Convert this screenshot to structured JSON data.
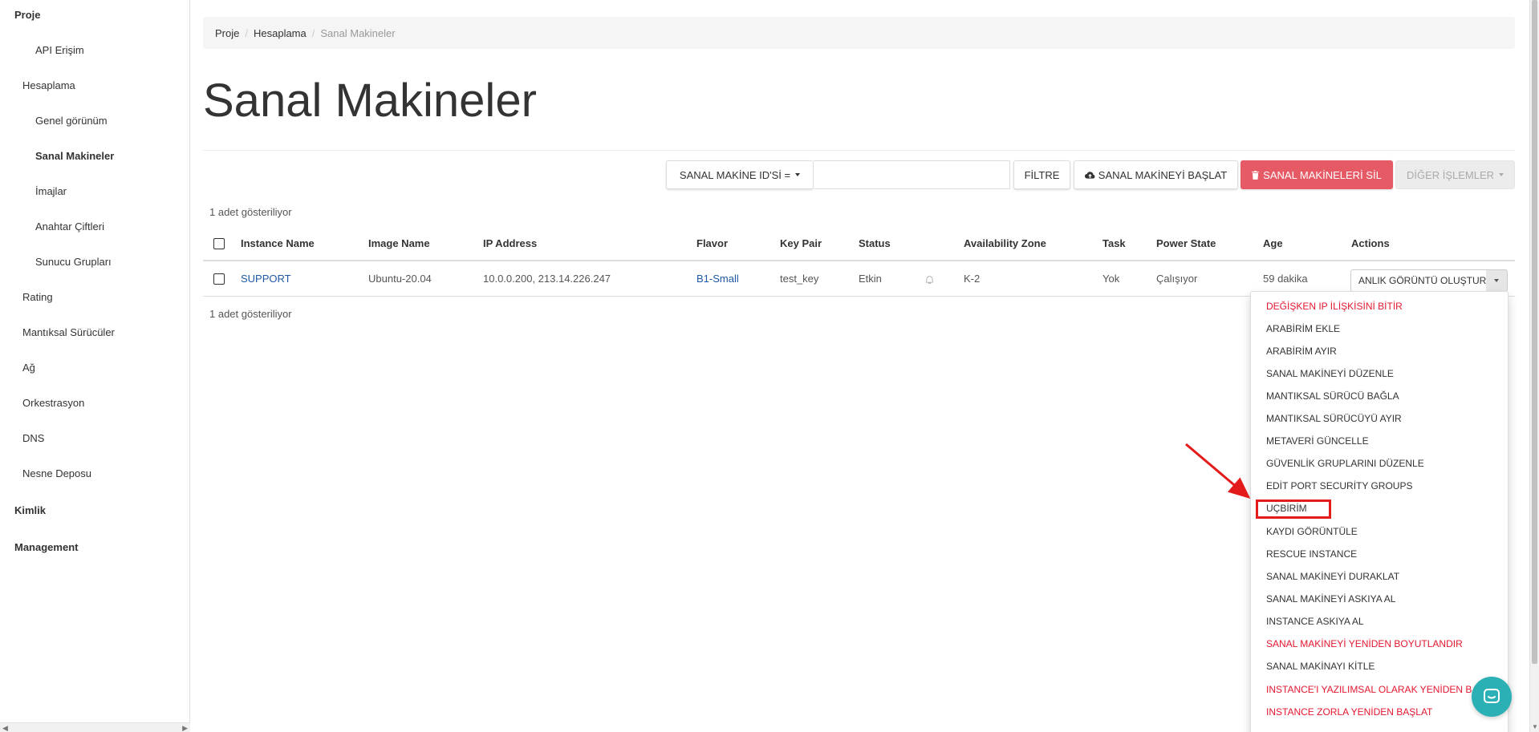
{
  "sidebar": {
    "groups": [
      {
        "label": "Proje"
      },
      {
        "label": "Kimlik"
      },
      {
        "label": "Management"
      }
    ],
    "items": [
      {
        "label": "API Erişim"
      },
      {
        "label": "Hesaplama"
      },
      {
        "label": "Genel görünüm"
      },
      {
        "label": "Sanal Makineler"
      },
      {
        "label": "İmajlar"
      },
      {
        "label": "Anahtar Çiftleri"
      },
      {
        "label": "Sunucu Grupları"
      },
      {
        "label": "Rating"
      },
      {
        "label": "Mantıksal Sürücüler"
      },
      {
        "label": "Ağ"
      },
      {
        "label": "Orkestrasyon"
      },
      {
        "label": "DNS"
      },
      {
        "label": "Nesne Deposu"
      }
    ]
  },
  "breadcrumb": [
    "Proje",
    "Hesaplama",
    "Sanal Makineler"
  ],
  "page_title": "Sanal Makineler",
  "toolbar": {
    "filter_select": "SANAL MAKİNE ID'Sİ =",
    "filter_value": "",
    "filter_button": "FİLTRE",
    "launch_button": "SANAL MAKİNEYİ BAŞLAT",
    "delete_button": "SANAL MAKİNELERİ SİL",
    "more_button": "DİĞER İŞLEMLER"
  },
  "count_text": "1 adet gösteriliyor",
  "table": {
    "columns": [
      "Instance Name",
      "Image Name",
      "IP Address",
      "Flavor",
      "Key Pair",
      "Status",
      "Availability Zone",
      "Task",
      "Power State",
      "Age",
      "Actions"
    ],
    "rows": [
      {
        "instance_name": "SUPPORT",
        "image_name": "Ubuntu-20.04",
        "ip_address": "10.0.0.200, 213.14.226.247",
        "flavor": "B1-Small",
        "key_pair": "test_key",
        "status": "Etkin",
        "availability_zone": "K-2",
        "task": "Yok",
        "power_state": "Çalışıyor",
        "age": "59 dakika",
        "action": "ANLIK GÖRÜNTÜ OLUŞTUR"
      }
    ]
  },
  "actions_menu": [
    {
      "label": "DEĞİŞKEN IP İLİŞKİSİNİ BİTİR",
      "danger": true
    },
    {
      "label": "ARABİRİM EKLE",
      "danger": false
    },
    {
      "label": "ARABİRİM AYIR",
      "danger": false
    },
    {
      "label": "SANAL MAKİNEYİ DÜZENLE",
      "danger": false
    },
    {
      "label": "MANTIKSAL SÜRÜCÜ BAĞLA",
      "danger": false
    },
    {
      "label": "MANTIKSAL SÜRÜCÜYÜ AYIR",
      "danger": false
    },
    {
      "label": "METAVERİ GÜNCELLE",
      "danger": false
    },
    {
      "label": "GÜVENLİK GRUPLARINI DÜZENLE",
      "danger": false
    },
    {
      "label": "EDİT PORT SECURİTY GROUPS",
      "danger": false
    },
    {
      "label": "UÇBİRİM",
      "danger": false,
      "highlighted": true
    },
    {
      "label": "KAYDI GÖRÜNTÜLE",
      "danger": false
    },
    {
      "label": "RESCUE INSTANCE",
      "danger": false
    },
    {
      "label": "SANAL MAKİNEYİ DURAKLAT",
      "danger": false
    },
    {
      "label": "SANAL MAKİNEYİ ASKIYA AL",
      "danger": false
    },
    {
      "label": "INSTANCE ASKIYA AL",
      "danger": false
    },
    {
      "label": "SANAL MAKİNEYİ YENİDEN BOYUTLANDIR",
      "danger": true
    },
    {
      "label": "SANAL MAKİNAYI KİTLE",
      "danger": false
    },
    {
      "label": "INSTANCE'I YAZILIMSAL OLARAK YENİDEN BAŞLAT",
      "danger": true
    },
    {
      "label": "INSTANCE ZORLA YENİDEN BAŞLAT",
      "danger": true
    }
  ],
  "colors": {
    "danger": "#e3172f",
    "link": "#1f58a6",
    "delete_button_bg": "#e65a66",
    "annotation": "#e31b1b",
    "chat": "#2bb0b5"
  }
}
